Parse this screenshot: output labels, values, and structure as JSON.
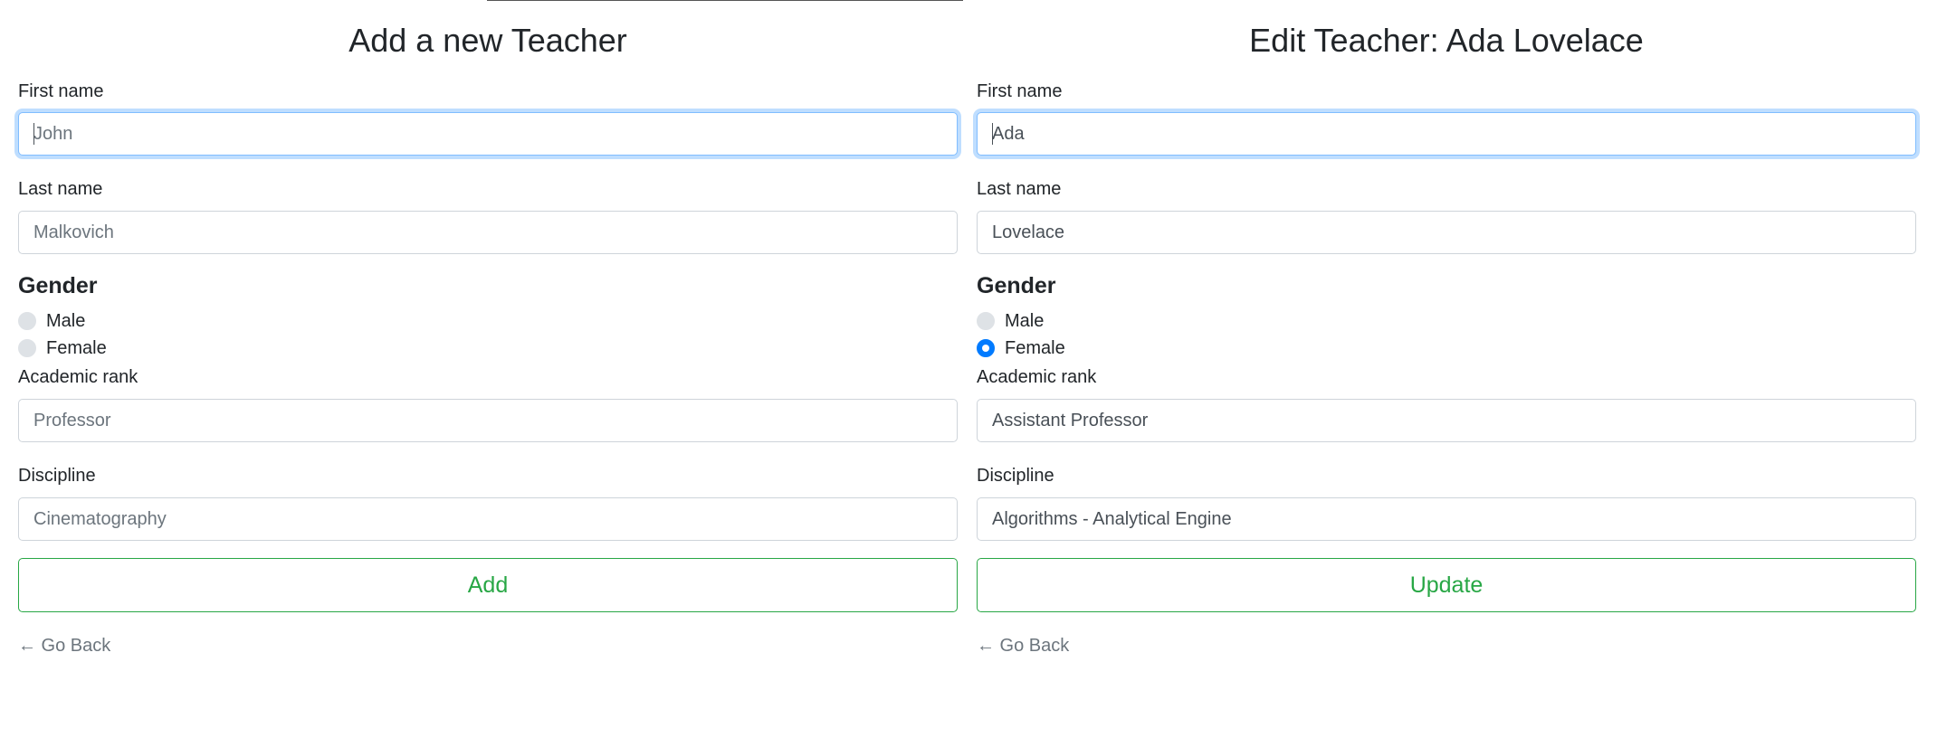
{
  "add_form": {
    "title": "Add a new Teacher",
    "first_name": {
      "label": "First name",
      "placeholder": "John",
      "value": ""
    },
    "last_name": {
      "label": "Last name",
      "placeholder": "Malkovich",
      "value": ""
    },
    "gender": {
      "heading": "Gender",
      "options": [
        "Male",
        "Female"
      ],
      "selected": null
    },
    "academic_rank": {
      "label": "Academic rank",
      "placeholder": "Professor",
      "value": ""
    },
    "discipline": {
      "label": "Discipline",
      "placeholder": "Cinematography",
      "value": ""
    },
    "submit_label": "Add",
    "back_label": "← Go Back"
  },
  "edit_form": {
    "title": "Edit Teacher: Ada Lovelace",
    "first_name": {
      "label": "First name",
      "value": "Ada"
    },
    "last_name": {
      "label": "Last name",
      "value": "Lovelace"
    },
    "gender": {
      "heading": "Gender",
      "options": [
        "Male",
        "Female"
      ],
      "selected": "Female"
    },
    "academic_rank": {
      "label": "Academic rank",
      "value": "Assistant Professor"
    },
    "discipline": {
      "label": "Discipline",
      "value": "Algorithms - Analytical Engine"
    },
    "submit_label": "Update",
    "back_label": "← Go Back"
  },
  "colors": {
    "success": "#28a745",
    "focus_border": "#80bdff",
    "radio_checked": "#007bff",
    "muted": "#6c757d"
  }
}
